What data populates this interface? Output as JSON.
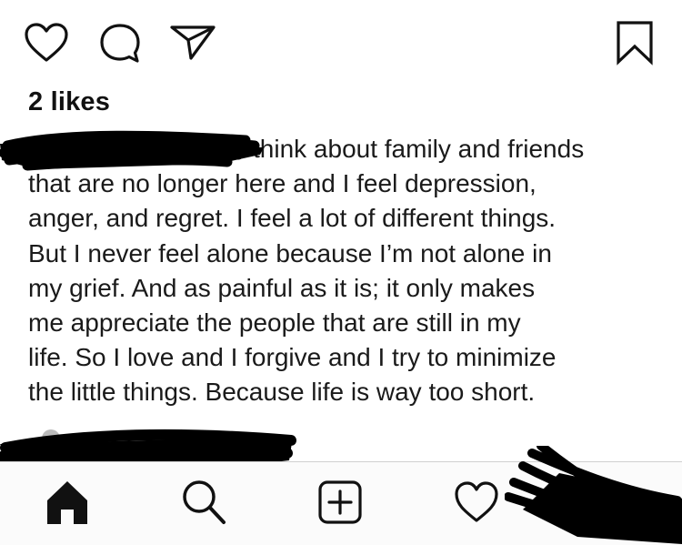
{
  "post": {
    "likes": "2 likes",
    "caption_lines": [
      "think about family and friends",
      "that are no longer here and I feel depression,",
      "anger, and regret. I feel a lot of different things.",
      "But I never feel alone because I’m not alone in",
      "my grief. And as painful as it is; it only makes",
      "me appreciate the people that are still in my",
      "life. So I love and I forgive and I try to minimize",
      "the little things. Because life is way too short."
    ]
  },
  "action_bar": {
    "icons": [
      "heart-icon",
      "comment-icon",
      "share-icon",
      "bookmark-icon"
    ]
  },
  "tab_bar": {
    "icons": [
      "home-icon",
      "search-icon",
      "add-icon",
      "activity-heart-icon"
    ]
  },
  "colors": {
    "text": "#1a1a1a",
    "redaction": "#000000",
    "divider": "#d0d0d0"
  }
}
